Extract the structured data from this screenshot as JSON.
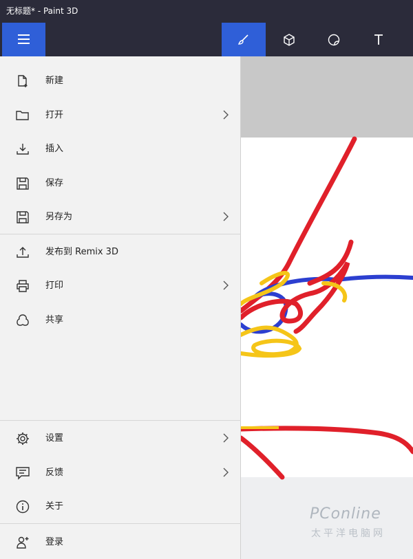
{
  "window": {
    "title": "无标题* - Paint 3D"
  },
  "toolbar": {
    "menu_icon": "hamburger-icon",
    "tools": [
      {
        "name": "brushes",
        "icon": "brush-icon",
        "active": true
      },
      {
        "name": "3d-shapes",
        "icon": "cube-icon",
        "active": false
      },
      {
        "name": "stickers",
        "icon": "sticker-icon",
        "active": false
      },
      {
        "name": "text",
        "icon": "text-icon",
        "active": false
      }
    ],
    "accent_color": "#2f5fd8"
  },
  "menu": {
    "items": [
      {
        "label": "新建",
        "icon": "new-file-icon",
        "submenu": false
      },
      {
        "label": "打开",
        "icon": "folder-icon",
        "submenu": true
      },
      {
        "label": "插入",
        "icon": "insert-icon",
        "submenu": false
      },
      {
        "label": "保存",
        "icon": "save-icon",
        "submenu": false
      },
      {
        "label": "另存为",
        "icon": "save-as-icon",
        "submenu": true
      },
      {
        "label": "发布到 Remix 3D",
        "icon": "upload-icon",
        "submenu": false
      },
      {
        "label": "打印",
        "icon": "print-icon",
        "submenu": true
      },
      {
        "label": "共享",
        "icon": "share-icon",
        "submenu": false
      }
    ],
    "footer_items": [
      {
        "label": "设置",
        "icon": "gear-icon",
        "submenu": true
      },
      {
        "label": "反馈",
        "icon": "feedback-icon",
        "submenu": true
      },
      {
        "label": "关于",
        "icon": "info-icon",
        "submenu": false
      },
      {
        "label": "登录",
        "icon": "sign-in-icon",
        "submenu": false
      }
    ]
  },
  "canvas": {
    "stroke_colors": [
      "#e0202a",
      "#2c3fd0",
      "#f5c518"
    ]
  },
  "watermark": {
    "text": "PConline",
    "subtext": "太平洋电脑网"
  }
}
